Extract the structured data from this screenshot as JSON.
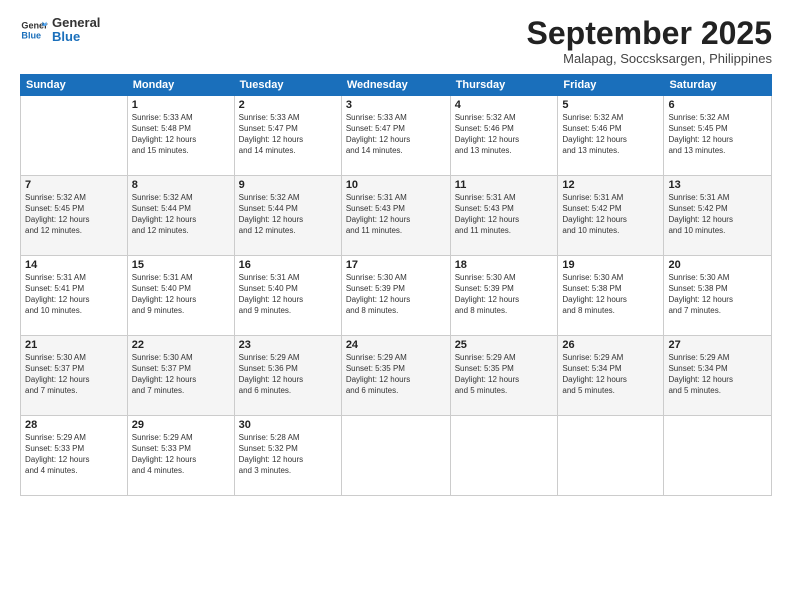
{
  "header": {
    "logo_line1": "General",
    "logo_line2": "Blue",
    "month": "September 2025",
    "location": "Malapag, Soccsksargen, Philippines"
  },
  "days_of_week": [
    "Sunday",
    "Monday",
    "Tuesday",
    "Wednesday",
    "Thursday",
    "Friday",
    "Saturday"
  ],
  "weeks": [
    [
      {
        "day": "",
        "info": ""
      },
      {
        "day": "1",
        "info": "Sunrise: 5:33 AM\nSunset: 5:48 PM\nDaylight: 12 hours\nand 15 minutes."
      },
      {
        "day": "2",
        "info": "Sunrise: 5:33 AM\nSunset: 5:47 PM\nDaylight: 12 hours\nand 14 minutes."
      },
      {
        "day": "3",
        "info": "Sunrise: 5:33 AM\nSunset: 5:47 PM\nDaylight: 12 hours\nand 14 minutes."
      },
      {
        "day": "4",
        "info": "Sunrise: 5:32 AM\nSunset: 5:46 PM\nDaylight: 12 hours\nand 13 minutes."
      },
      {
        "day": "5",
        "info": "Sunrise: 5:32 AM\nSunset: 5:46 PM\nDaylight: 12 hours\nand 13 minutes."
      },
      {
        "day": "6",
        "info": "Sunrise: 5:32 AM\nSunset: 5:45 PM\nDaylight: 12 hours\nand 13 minutes."
      }
    ],
    [
      {
        "day": "7",
        "info": "Sunrise: 5:32 AM\nSunset: 5:45 PM\nDaylight: 12 hours\nand 12 minutes."
      },
      {
        "day": "8",
        "info": "Sunrise: 5:32 AM\nSunset: 5:44 PM\nDaylight: 12 hours\nand 12 minutes."
      },
      {
        "day": "9",
        "info": "Sunrise: 5:32 AM\nSunset: 5:44 PM\nDaylight: 12 hours\nand 12 minutes."
      },
      {
        "day": "10",
        "info": "Sunrise: 5:31 AM\nSunset: 5:43 PM\nDaylight: 12 hours\nand 11 minutes."
      },
      {
        "day": "11",
        "info": "Sunrise: 5:31 AM\nSunset: 5:43 PM\nDaylight: 12 hours\nand 11 minutes."
      },
      {
        "day": "12",
        "info": "Sunrise: 5:31 AM\nSunset: 5:42 PM\nDaylight: 12 hours\nand 10 minutes."
      },
      {
        "day": "13",
        "info": "Sunrise: 5:31 AM\nSunset: 5:42 PM\nDaylight: 12 hours\nand 10 minutes."
      }
    ],
    [
      {
        "day": "14",
        "info": "Sunrise: 5:31 AM\nSunset: 5:41 PM\nDaylight: 12 hours\nand 10 minutes."
      },
      {
        "day": "15",
        "info": "Sunrise: 5:31 AM\nSunset: 5:40 PM\nDaylight: 12 hours\nand 9 minutes."
      },
      {
        "day": "16",
        "info": "Sunrise: 5:31 AM\nSunset: 5:40 PM\nDaylight: 12 hours\nand 9 minutes."
      },
      {
        "day": "17",
        "info": "Sunrise: 5:30 AM\nSunset: 5:39 PM\nDaylight: 12 hours\nand 8 minutes."
      },
      {
        "day": "18",
        "info": "Sunrise: 5:30 AM\nSunset: 5:39 PM\nDaylight: 12 hours\nand 8 minutes."
      },
      {
        "day": "19",
        "info": "Sunrise: 5:30 AM\nSunset: 5:38 PM\nDaylight: 12 hours\nand 8 minutes."
      },
      {
        "day": "20",
        "info": "Sunrise: 5:30 AM\nSunset: 5:38 PM\nDaylight: 12 hours\nand 7 minutes."
      }
    ],
    [
      {
        "day": "21",
        "info": "Sunrise: 5:30 AM\nSunset: 5:37 PM\nDaylight: 12 hours\nand 7 minutes."
      },
      {
        "day": "22",
        "info": "Sunrise: 5:30 AM\nSunset: 5:37 PM\nDaylight: 12 hours\nand 7 minutes."
      },
      {
        "day": "23",
        "info": "Sunrise: 5:29 AM\nSunset: 5:36 PM\nDaylight: 12 hours\nand 6 minutes."
      },
      {
        "day": "24",
        "info": "Sunrise: 5:29 AM\nSunset: 5:35 PM\nDaylight: 12 hours\nand 6 minutes."
      },
      {
        "day": "25",
        "info": "Sunrise: 5:29 AM\nSunset: 5:35 PM\nDaylight: 12 hours\nand 5 minutes."
      },
      {
        "day": "26",
        "info": "Sunrise: 5:29 AM\nSunset: 5:34 PM\nDaylight: 12 hours\nand 5 minutes."
      },
      {
        "day": "27",
        "info": "Sunrise: 5:29 AM\nSunset: 5:34 PM\nDaylight: 12 hours\nand 5 minutes."
      }
    ],
    [
      {
        "day": "28",
        "info": "Sunrise: 5:29 AM\nSunset: 5:33 PM\nDaylight: 12 hours\nand 4 minutes."
      },
      {
        "day": "29",
        "info": "Sunrise: 5:29 AM\nSunset: 5:33 PM\nDaylight: 12 hours\nand 4 minutes."
      },
      {
        "day": "30",
        "info": "Sunrise: 5:28 AM\nSunset: 5:32 PM\nDaylight: 12 hours\nand 3 minutes."
      },
      {
        "day": "",
        "info": ""
      },
      {
        "day": "",
        "info": ""
      },
      {
        "day": "",
        "info": ""
      },
      {
        "day": "",
        "info": ""
      }
    ]
  ]
}
